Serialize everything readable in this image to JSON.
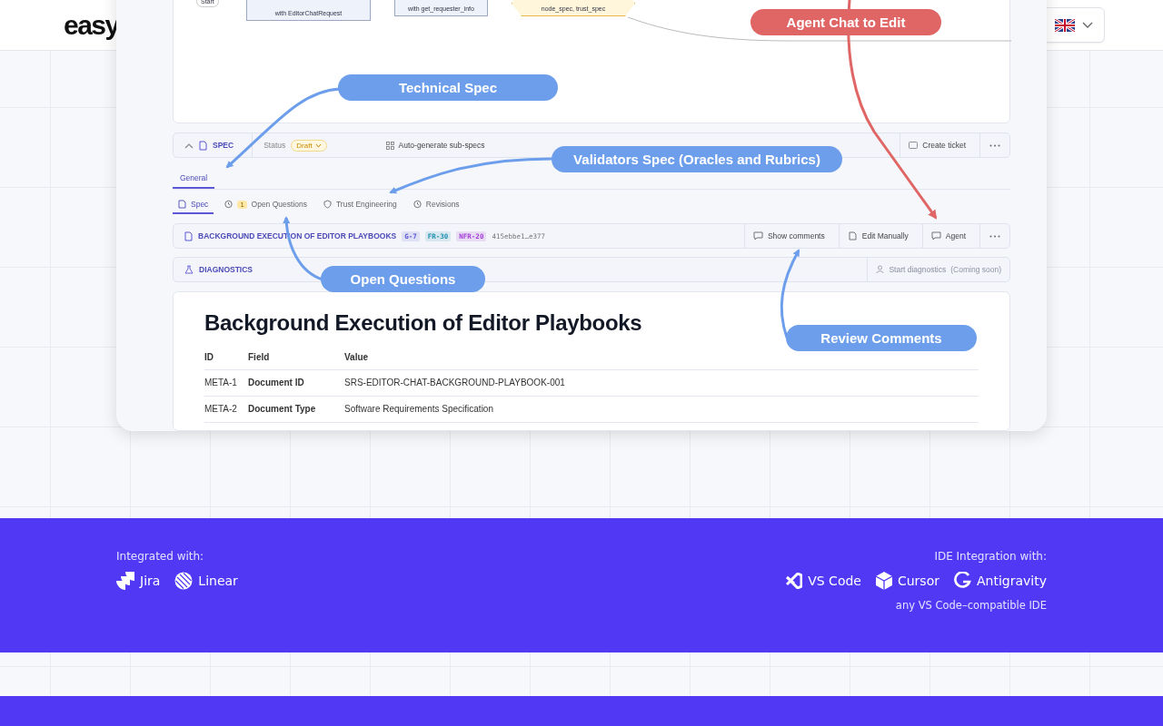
{
  "header": {
    "logo": "easy"
  },
  "screenshot": {
    "diagram_nodes": [
      {
        "kind": "pill",
        "text": "Start"
      },
      {
        "kind": "box",
        "text": "with EditorChatRequest"
      },
      {
        "kind": "box",
        "text": "with get_requester_info"
      },
      {
        "kind": "hexagon",
        "text": "node_spec, trust_spec"
      }
    ],
    "spec_bar": {
      "expanded": true,
      "label": "SPEC",
      "status_label": "Status",
      "status": "Draft",
      "action": "Auto-generate sub-specs",
      "button": "Create ticket"
    },
    "tabs": [
      {
        "label": "General",
        "selected": true
      }
    ],
    "subtabs": [
      {
        "label": "Spec",
        "selected": true
      },
      {
        "label": "Open Questions",
        "badge": "1",
        "selected": false
      },
      {
        "label": "Trust Engineering",
        "selected": false
      },
      {
        "label": "Revisions",
        "selected": false
      }
    ],
    "doc_bar": {
      "title": "BACKGROUND EXECUTION OF EDITOR PLAYBOOKS",
      "tags": [
        {
          "text": "G-7",
          "color": "#5b57d6"
        },
        {
          "text": "FR-30",
          "color": "#1d8fb0"
        },
        {
          "text": "NFR-20",
          "color": "#a43ad6"
        }
      ],
      "hash": "415ebbe1…e377",
      "buttons": [
        "Show comments",
        "Edit Manually",
        "Agent"
      ]
    },
    "diagnostics": {
      "label": "DIAGNOSTICS",
      "action": "Start diagnostics",
      "note": "(Coming soon)",
      "disabled": true
    },
    "document": {
      "heading": "Background Execution of Editor Playbooks",
      "columns": [
        "ID",
        "Field",
        "Value"
      ],
      "rows": [
        [
          "META-1",
          "Document ID",
          "SRS-EDITOR-CHAT-BACKGROUND-PLAYBOOK-001"
        ],
        [
          "META-2",
          "Document Type",
          "Software Requirements Specification"
        ]
      ]
    },
    "callouts": [
      {
        "text": "Agent Chat to Edit",
        "color": "#e06666"
      },
      {
        "text": "Technical Spec",
        "color": "#6d9eeb"
      },
      {
        "text": "Validators Spec (Oracles and Rubrics)",
        "color": "#6d9eeb"
      },
      {
        "text": "Open Questions",
        "color": "#6d9eeb"
      },
      {
        "text": "Review Comments",
        "color": "#6d9eeb"
      }
    ]
  },
  "footer": {
    "integrations_label": "Integrated with:",
    "integrations": [
      "Jira",
      "Linear"
    ],
    "ide_label": "IDE Integration with:",
    "ides": [
      "VS Code",
      "Cursor",
      "Antigravity"
    ],
    "ide_note": "any VS Code–compatible IDE"
  }
}
